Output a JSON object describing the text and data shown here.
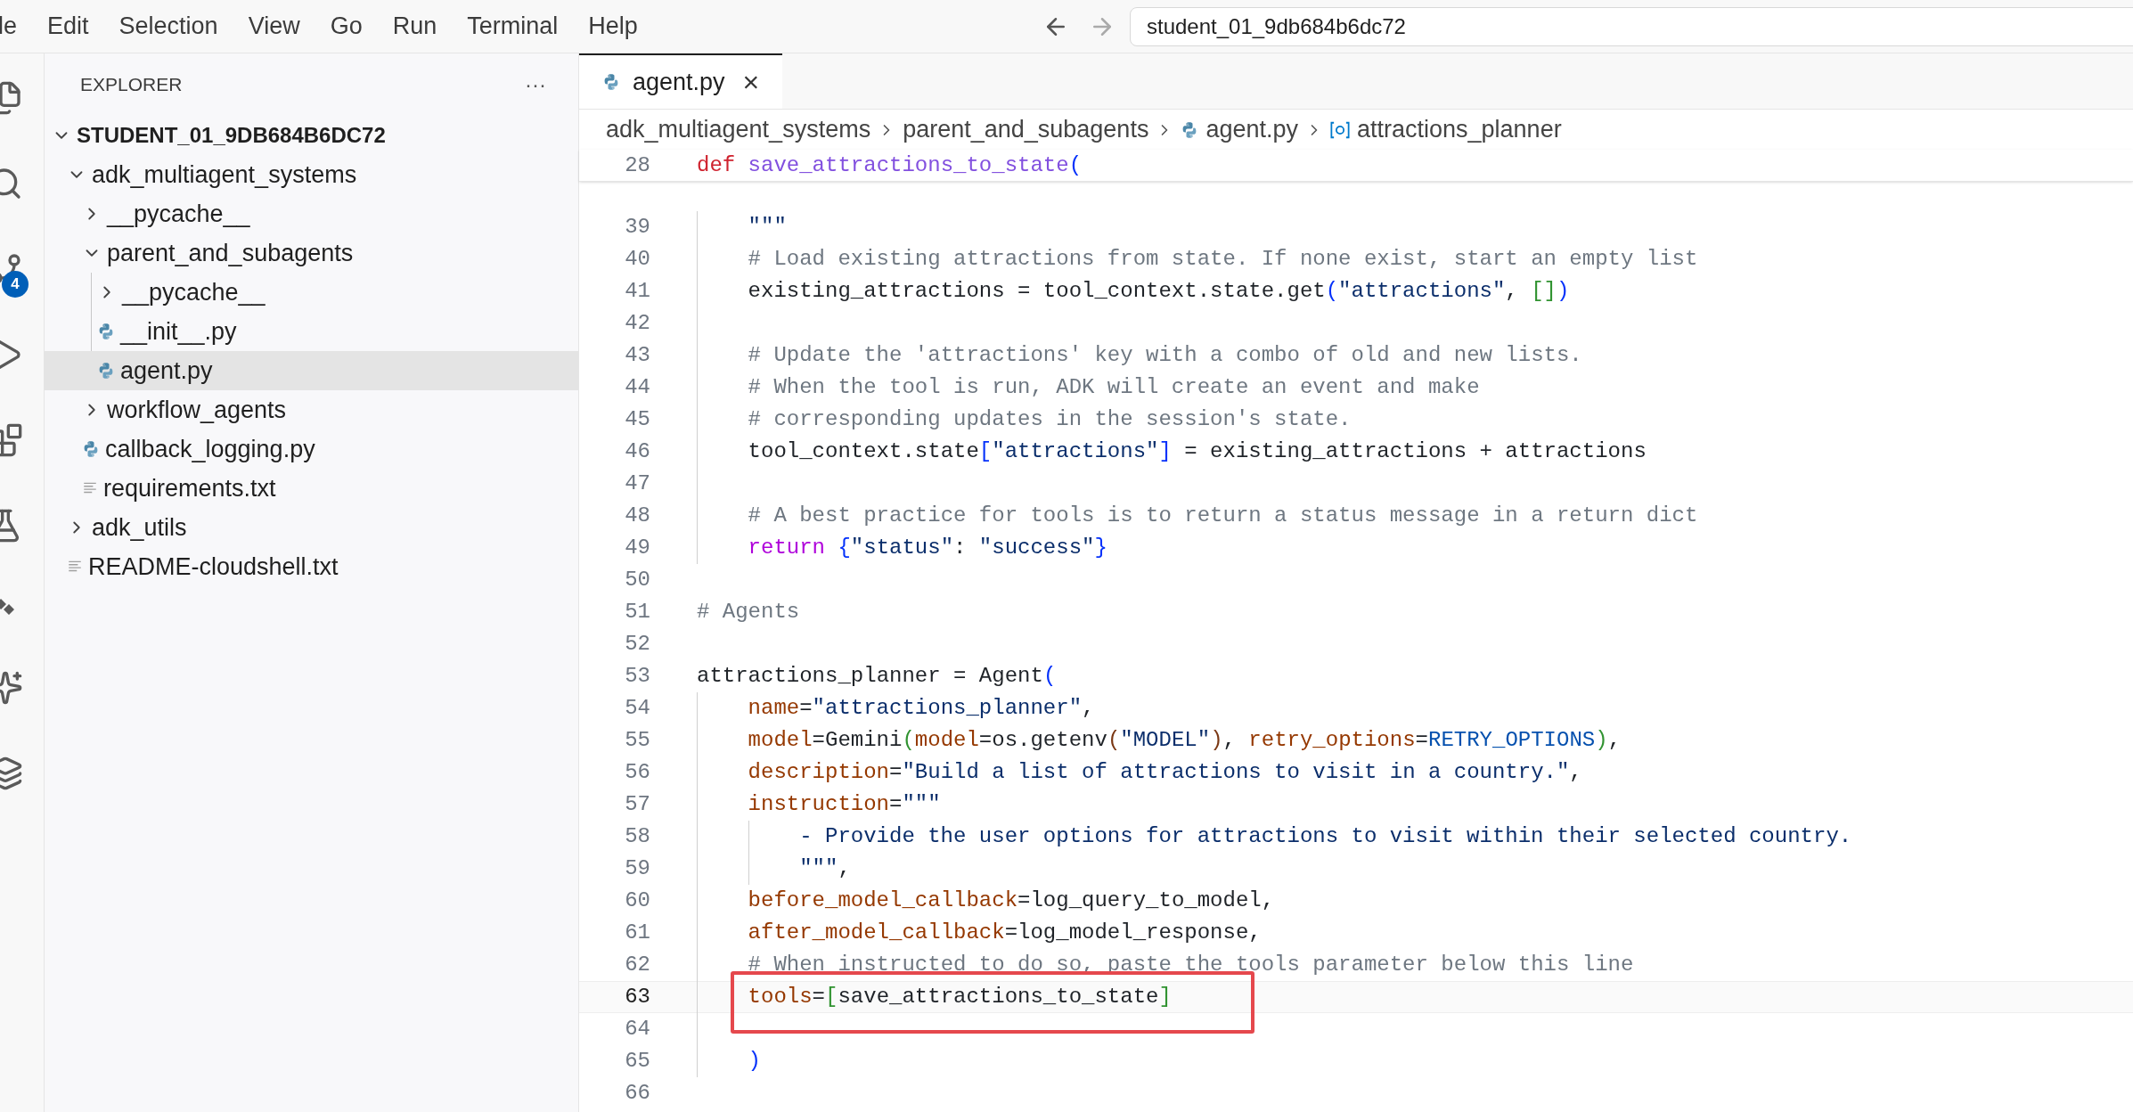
{
  "menu_bar": [
    "le",
    "Edit",
    "Selection",
    "View",
    "Go",
    "Run",
    "Terminal",
    "Help"
  ],
  "search": {
    "value": "student_01_9db684b6dc72"
  },
  "activity_bar": [
    {
      "kind": "files"
    },
    {
      "kind": "search"
    },
    {
      "kind": "source-control",
      "badge": "4"
    },
    {
      "kind": "run"
    },
    {
      "kind": "extensions"
    },
    {
      "kind": "flask"
    },
    {
      "kind": "diamonds"
    },
    {
      "kind": "sparkle-list"
    },
    {
      "kind": "sparkle-stack"
    }
  ],
  "explorer": {
    "title": "EXPLORER",
    "more": "···",
    "tree": [
      {
        "label": "STUDENT_01_9DB684B6DC72",
        "kind": "root",
        "expanded": true,
        "selected": false,
        "children": [
          {
            "label": "adk_multiagent_systems",
            "kind": "folder",
            "expanded": true,
            "selected": false,
            "children": [
              {
                "label": "__pycache__",
                "kind": "folder",
                "expanded": false,
                "selected": false
              },
              {
                "label": "parent_and_subagents",
                "kind": "folder",
                "expanded": true,
                "selected": false,
                "children": [
                  {
                    "label": "__pycache__",
                    "kind": "folder",
                    "expanded": false,
                    "selected": false
                  },
                  {
                    "label": "__init__.py",
                    "kind": "python",
                    "selected": false
                  },
                  {
                    "label": "agent.py",
                    "kind": "python",
                    "selected": true
                  }
                ]
              },
              {
                "label": "workflow_agents",
                "kind": "folder",
                "expanded": false,
                "selected": false
              },
              {
                "label": "callback_logging.py",
                "kind": "python",
                "selected": false
              },
              {
                "label": "requirements.txt",
                "kind": "text",
                "selected": false
              }
            ]
          },
          {
            "label": "adk_utils",
            "kind": "folder",
            "expanded": false,
            "selected": false
          },
          {
            "label": "README-cloudshell.txt",
            "kind": "text",
            "selected": false
          }
        ]
      }
    ]
  },
  "editor": {
    "tabs": [
      {
        "label": "agent.py",
        "close": "×",
        "selected": true
      }
    ],
    "breadcrumbs": [
      {
        "label": "adk_multiagent_systems",
        "kind": "folder"
      },
      {
        "label": "parent_and_subagents",
        "kind": "folder"
      },
      {
        "label": "agent.py",
        "kind": "python"
      },
      {
        "label": "attractions_planner",
        "kind": "symbol"
      }
    ],
    "sticky_line": {
      "number": "28",
      "tokens": [
        {
          "kind": "keyword",
          "text": "def "
        },
        {
          "kind": "function",
          "text": "save_attractions_to_state"
        },
        {
          "kind": "bracket1",
          "text": "("
        }
      ]
    },
    "lines": [
      {
        "block": [
          {
            "number": "39",
            "current": false,
            "boxed": false,
            "tokens": [
              {
                "kind": "string",
                "text": "\"\"\""
              }
            ]
          },
          {
            "number": "40",
            "current": false,
            "boxed": false,
            "tokens": [
              {
                "kind": "comment",
                "text": "# Load existing attractions from state. If none exist, start an empty list"
              }
            ]
          },
          {
            "number": "41",
            "current": false,
            "boxed": false,
            "tokens": [
              {
                "kind": "plain",
                "text": "existing_attractions = tool_context.state.get"
              },
              {
                "kind": "bracket1",
                "text": "("
              },
              {
                "kind": "string",
                "text": "\"attractions\""
              },
              {
                "kind": "plain",
                "text": ","
              },
              {
                "kind": "bracket2",
                "text": " []"
              },
              {
                "kind": "bracket1",
                "text": ")"
              }
            ]
          },
          {
            "number": "42",
            "current": false,
            "boxed": false
          },
          {
            "number": "43",
            "current": false,
            "boxed": false,
            "tokens": [
              {
                "kind": "comment",
                "text": "# Update the 'attractions' key with a combo of old and new lists."
              }
            ]
          },
          {
            "number": "44",
            "current": false,
            "boxed": false,
            "tokens": [
              {
                "kind": "comment",
                "text": "# When the tool is run, ADK will create an event and make"
              }
            ]
          },
          {
            "number": "45",
            "current": false,
            "boxed": false,
            "tokens": [
              {
                "kind": "comment",
                "text": "# corresponding updates in the session's state."
              }
            ]
          },
          {
            "number": "46",
            "current": false,
            "boxed": false,
            "tokens": [
              {
                "kind": "plain",
                "text": "tool_context.state"
              },
              {
                "kind": "bracket1",
                "text": "["
              },
              {
                "kind": "string",
                "text": "\"attractions\""
              },
              {
                "kind": "bracket1",
                "text": "]"
              },
              {
                "kind": "plain",
                "text": " = existing_attractions + attractions"
              }
            ]
          },
          {
            "number": "47",
            "current": false,
            "boxed": false
          },
          {
            "number": "48",
            "current": false,
            "boxed": false,
            "tokens": [
              {
                "kind": "comment",
                "text": "# A best practice for tools is to return a status message in a return dict"
              }
            ]
          },
          {
            "number": "49",
            "current": false,
            "boxed": false,
            "tokens": [
              {
                "kind": "control",
                "text": "return "
              },
              {
                "kind": "bracket1",
                "text": "{"
              },
              {
                "kind": "string",
                "text": "\"status\""
              },
              {
                "kind": "plain",
                "text": ": "
              },
              {
                "kind": "string",
                "text": "\"success\""
              },
              {
                "kind": "bracket1",
                "text": "}"
              }
            ]
          }
        ]
      },
      {
        "number": "50",
        "current": false,
        "boxed": false
      },
      {
        "number": "51",
        "current": false,
        "boxed": false,
        "tokens": [
          {
            "kind": "comment",
            "text": "# Agents"
          }
        ]
      },
      {
        "number": "52",
        "current": false,
        "boxed": false
      },
      {
        "number": "53",
        "current": false,
        "boxed": false,
        "tokens": [
          {
            "kind": "plain",
            "text": "attractions_planner = Agent"
          },
          {
            "kind": "bracket1",
            "text": "("
          }
        ]
      },
      {
        "block": [
          {
            "number": "54",
            "current": false,
            "boxed": false,
            "tokens": [
              {
                "kind": "param",
                "text": "name"
              },
              {
                "kind": "plain",
                "text": "="
              },
              {
                "kind": "string",
                "text": "\"attractions_planner\""
              },
              {
                "kind": "plain",
                "text": ","
              }
            ]
          },
          {
            "number": "55",
            "current": false,
            "boxed": false,
            "tokens": [
              {
                "kind": "param",
                "text": "model"
              },
              {
                "kind": "plain",
                "text": "=Gemini"
              },
              {
                "kind": "bracket2",
                "text": "("
              },
              {
                "kind": "param",
                "text": "model"
              },
              {
                "kind": "plain",
                "text": "=os.getenv"
              },
              {
                "kind": "bracket3",
                "text": "("
              },
              {
                "kind": "string",
                "text": "\"MODEL\""
              },
              {
                "kind": "bracket3",
                "text": ")"
              },
              {
                "kind": "plain",
                "text": ","
              },
              {
                "kind": "param",
                "text": " retry_options"
              },
              {
                "kind": "plain",
                "text": "="
              },
              {
                "kind": "constant",
                "text": "RETRY_OPTIONS"
              },
              {
                "kind": "bracket2",
                "text": ")"
              },
              {
                "kind": "plain",
                "text": ","
              }
            ]
          },
          {
            "number": "56",
            "current": false,
            "boxed": false,
            "tokens": [
              {
                "kind": "param",
                "text": "description"
              },
              {
                "kind": "plain",
                "text": "="
              },
              {
                "kind": "string",
                "text": "\"Build a list of attractions to visit in a country.\""
              },
              {
                "kind": "plain",
                "text": ","
              }
            ]
          },
          {
            "number": "57",
            "current": false,
            "boxed": false,
            "tokens": [
              {
                "kind": "param",
                "text": "instruction"
              },
              {
                "kind": "plain",
                "text": "="
              },
              {
                "kind": "string",
                "text": "\"\"\""
              }
            ]
          },
          {
            "block": [
              {
                "number": "58",
                "current": false,
                "boxed": false,
                "tokens": [
                  {
                    "kind": "string",
                    "text": "- Provide the user options for attractions to visit within their selected country."
                  }
                ]
              },
              {
                "number": "59",
                "current": false,
                "boxed": false,
                "tokens": [
                  {
                    "kind": "string",
                    "text": "\"\"\""
                  },
                  {
                    "kind": "plain",
                    "text": ","
                  }
                ]
              }
            ]
          },
          {
            "number": "60",
            "current": false,
            "boxed": false,
            "tokens": [
              {
                "kind": "param",
                "text": "before_model_callback"
              },
              {
                "kind": "plain",
                "text": "=log_query_to_model,"
              }
            ]
          },
          {
            "number": "61",
            "current": false,
            "boxed": false,
            "tokens": [
              {
                "kind": "param",
                "text": "after_model_callback"
              },
              {
                "kind": "plain",
                "text": "=log_model_response,"
              }
            ]
          },
          {
            "number": "62",
            "current": false,
            "boxed": false,
            "tokens": [
              {
                "kind": "comment",
                "text": "# When instructed to do so, paste the tools parameter below this line"
              }
            ]
          },
          {
            "number": "63",
            "current": true,
            "boxed": true,
            "tokens": [
              {
                "kind": "param",
                "text": "tools"
              },
              {
                "kind": "plain",
                "text": "="
              },
              {
                "kind": "bracket2",
                "text": "["
              },
              {
                "kind": "plain",
                "text": "save_attractions_to_state"
              },
              {
                "kind": "bracket2",
                "text": "]"
              }
            ]
          },
          {
            "number": "64",
            "current": false,
            "boxed": false
          },
          {
            "number": "65",
            "current": false,
            "boxed": false,
            "tokens": [
              {
                "kind": "bracket1",
                "text": ")"
              }
            ]
          }
        ]
      },
      {
        "number": "66",
        "current": false,
        "boxed": false
      }
    ]
  }
}
